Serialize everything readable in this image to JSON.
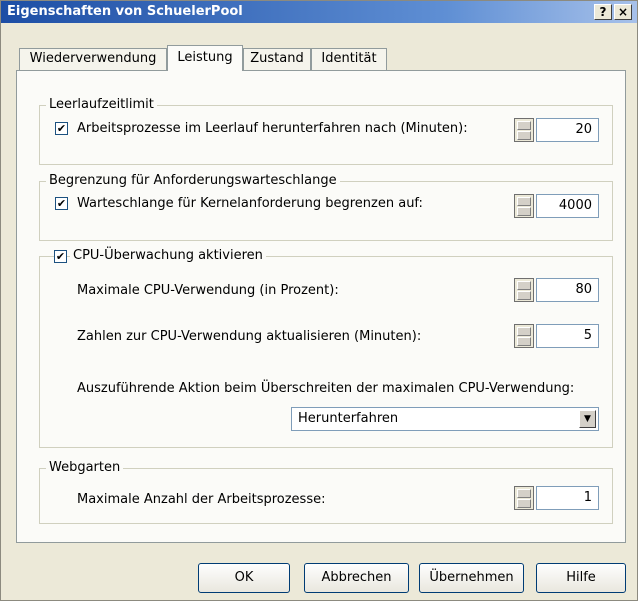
{
  "window": {
    "title": "Eigenschaften von SchuelerPool",
    "help_label": "?",
    "close_label": "×"
  },
  "tabs": [
    "Wiederverwendung",
    "Leistung",
    "Zustand",
    "Identität"
  ],
  "groups": {
    "idle": {
      "legend": "Leerlaufzeitlimit",
      "checkbox_label": "Arbeitsprozesse im Leerlauf herunterfahren nach (Minuten):",
      "checked": true,
      "value": "20"
    },
    "queue": {
      "legend": "Begrenzung für Anforderungswarteschlange",
      "checkbox_label": "Warteschlange für Kernelanforderung begrenzen auf:",
      "checked": true,
      "value": "4000"
    },
    "cpu": {
      "legend": "CPU-Überwachung aktivieren",
      "checked": true,
      "max_label": "Maximale CPU-Verwendung (in Prozent):",
      "max_value": "80",
      "refresh_label": "Zahlen zur CPU-Verwendung aktualisieren (Minuten):",
      "refresh_value": "5",
      "action_label": "Auszuführende Aktion beim Überschreiten der maximalen CPU-Verwendung:",
      "action_value": "Herunterfahren"
    },
    "webgarden": {
      "legend": "Webgarten",
      "label": "Maximale Anzahl der Arbeitsprozesse:",
      "value": "1"
    }
  },
  "buttons": {
    "ok": "OK",
    "cancel": "Abbrechen",
    "apply": "Übernehmen",
    "help": "Hilfe"
  },
  "check_glyph": "✔"
}
